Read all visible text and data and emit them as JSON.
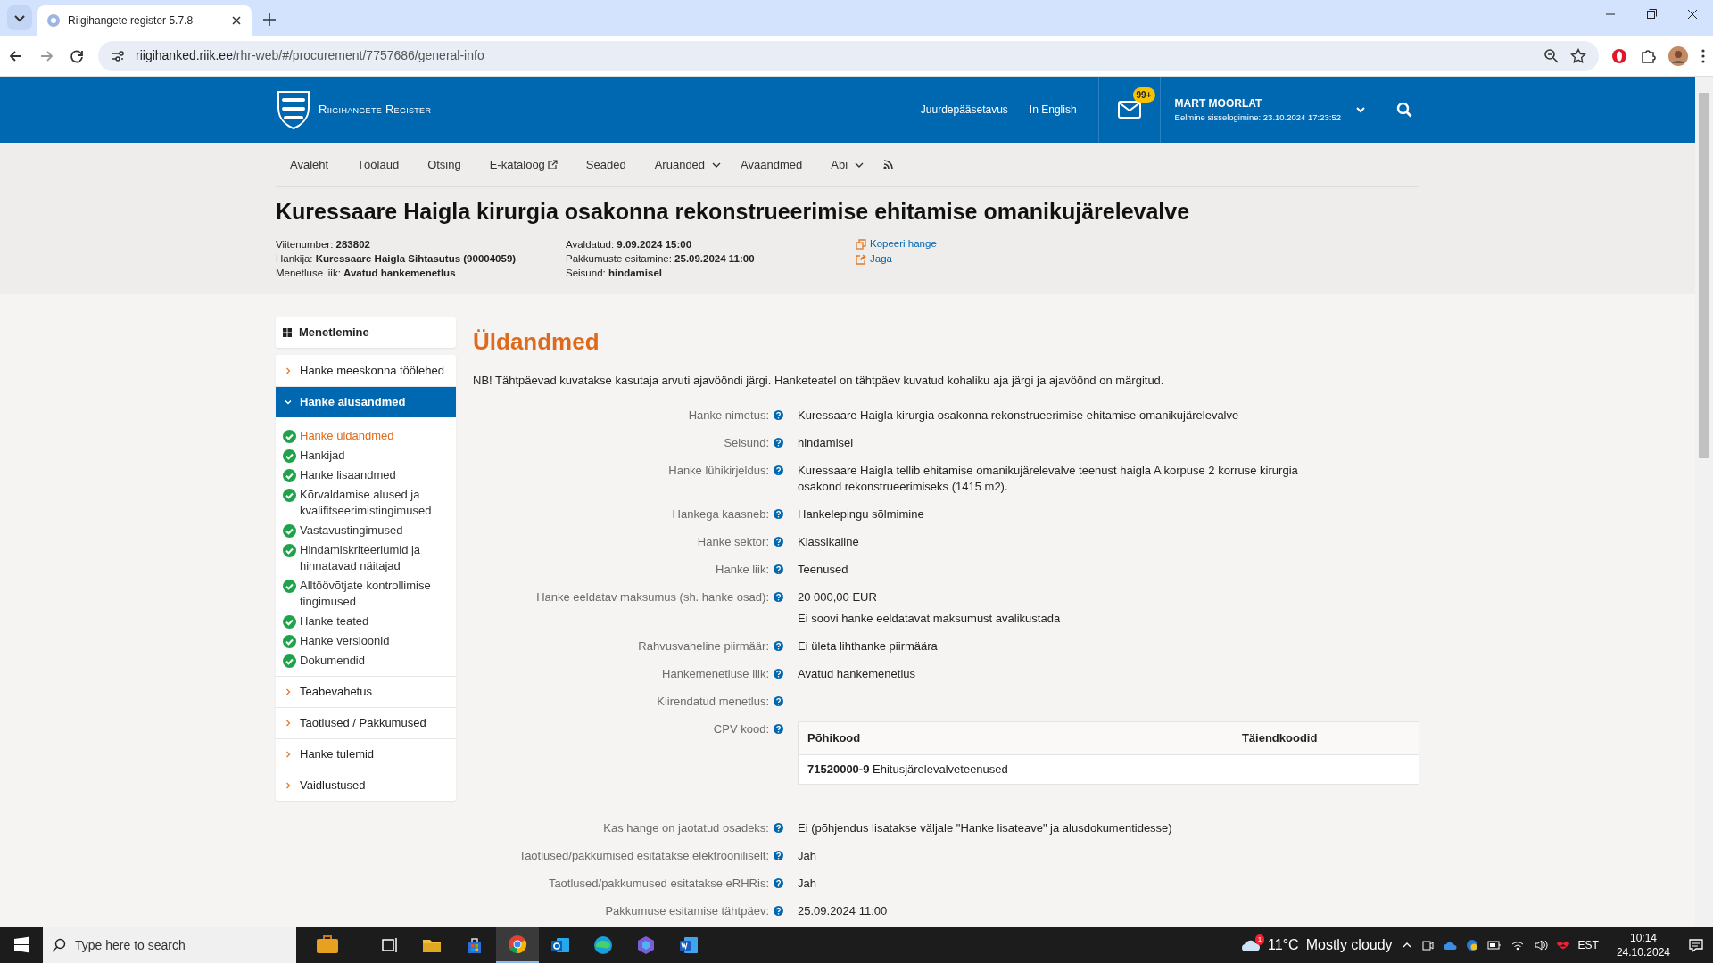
{
  "browser": {
    "tabs": [
      {
        "title": "Riigihangete register 5.7.8",
        "selected": true
      }
    ],
    "url_host": "riigihanked.riik.ee",
    "url_path": "/rhr-web/#/procurement/7757686/general-info"
  },
  "header": {
    "logo_text": "Riigihangete Register",
    "links": [
      "Juurdepääsetavus",
      "In English"
    ],
    "mail_badge": "99+",
    "user_name": "MART MOORLAT",
    "last_login": "Eelmine sisselogimine: 23.10.2024 17:23:52"
  },
  "nav": [
    {
      "kind": "plain",
      "label": "Avaleht"
    },
    {
      "kind": "plain",
      "label": "Töölaud"
    },
    {
      "kind": "plain",
      "label": "Otsing"
    },
    {
      "kind": "external",
      "label": "E-kataloog"
    },
    {
      "kind": "plain",
      "label": "Seaded"
    },
    {
      "kind": "dropdown",
      "label": "Aruanded"
    },
    {
      "kind": "plain",
      "label": "Avaandmed"
    },
    {
      "kind": "dropdown",
      "label": "Abi"
    },
    {
      "kind": "rss"
    }
  ],
  "procurement": {
    "title": "Kuressaare Haigla kirurgia osakonna rekonstrueerimise ehitamise omanikujärelevalve",
    "meta_columns": [
      [
        "Viitenumber: **283802**",
        "Hankija: **Kuressaare Haigla Sihtasutus (90004059)**",
        "Menetluse liik: **Avatud hankemenetlus**"
      ],
      [
        "Avaldatud: **9.09.2024 15:00**",
        "Pakkumuste esitamine: **25.09.2024 11:00**",
        "Seisund: **hindamisel**"
      ]
    ],
    "actions": [
      {
        "kind": "copy",
        "label": "Kopeeri hange"
      },
      {
        "kind": "share",
        "label": "Jaga"
      }
    ]
  },
  "sidebar": {
    "title": "Menetlemine",
    "sections": [
      {
        "label": "Hanke meeskonna töölehed",
        "expanded": false
      },
      {
        "label": "Hanke alusandmed",
        "expanded": true,
        "children": [
          {
            "label": "Hanke üldandmed",
            "done": true,
            "selected": true
          },
          {
            "label": "Hankijad",
            "done": true,
            "selected": false
          },
          {
            "label": "Hanke lisaandmed",
            "done": true,
            "selected": false
          },
          {
            "label": "Kõrvaldamise alused ja kvalifitseerimistingimused",
            "done": true,
            "selected": false
          },
          {
            "label": "Vastavustingimused",
            "done": true,
            "selected": false
          },
          {
            "label": "Hindamiskriteeriumid ja hinnatavad näitajad",
            "done": true,
            "selected": false
          },
          {
            "label": "Alltöövõtjate kontrollimise tingimused",
            "done": true,
            "selected": false
          },
          {
            "label": "Hanke teated",
            "done": true,
            "selected": false
          },
          {
            "label": "Hanke versioonid",
            "done": true,
            "selected": false
          },
          {
            "label": "Dokumendid",
            "done": true,
            "selected": false
          }
        ]
      },
      {
        "label": "Teabevahetus",
        "expanded": false
      },
      {
        "label": "Taotlused / Pakkumused",
        "expanded": false
      },
      {
        "label": "Hanke tulemid",
        "expanded": false
      },
      {
        "label": "Vaidlustused",
        "expanded": false
      }
    ]
  },
  "main": {
    "heading": "Üldandmed",
    "note": "NB! Tähtpäevad kuvatakse kasutaja arvuti ajavööndi järgi. Hanketeatel on tähtpäev kuvatud kohaliku aja järgi ja ajavöönd on märgitud.",
    "fields": [
      {
        "kind": "text",
        "label": "Hanke nimetus:",
        "values": [
          "Kuressaare Haigla kirurgia osakonna rekonstrueerimise ehitamise omanikujärelevalve"
        ]
      },
      {
        "kind": "text",
        "label": "Seisund:",
        "values": [
          "hindamisel"
        ]
      },
      {
        "kind": "text",
        "label": "Hanke lühikirjeldus:",
        "values": [
          "Kuressaare Haigla tellib ehitamise omanikujärelevalve teenust haigla A korpuse 2 korruse kirurgia osakond rekonstrueerimiseks (1415 m2)."
        ]
      },
      {
        "kind": "text",
        "label": "Hankega kaasneb:",
        "values": [
          "Hankelepingu sõlmimine"
        ]
      },
      {
        "kind": "text",
        "label": "Hanke sektor:",
        "values": [
          "Klassikaline"
        ]
      },
      {
        "kind": "text",
        "label": "Hanke liik:",
        "values": [
          "Teenused"
        ]
      },
      {
        "kind": "text",
        "label": "Hanke eeldatav maksumus (sh. hanke osad):",
        "values": [
          "20 000,00 EUR",
          "Ei soovi hanke eeldatavat maksumust avalikustada"
        ]
      },
      {
        "kind": "text",
        "label": "Rahvusvaheline piirmäär:",
        "values": [
          "Ei ületa lihthanke piirmäära"
        ]
      },
      {
        "kind": "text",
        "label": "Hankemenetluse liik:",
        "values": [
          "Avatud hankemenetlus"
        ]
      },
      {
        "kind": "text",
        "label": "Kiirendatud menetlus:"
      },
      {
        "kind": "table",
        "label": "CPV kood:",
        "columns": [
          "Põhikood",
          "Täiendkoodid"
        ],
        "rows": [
          [
            "**71520000-9** Ehitusjärelevalveteenused"
          ]
        ]
      },
      {
        "kind": "text",
        "label": "Kas hange on jaotatud osadeks:",
        "values": [
          "Ei (põhjendus lisatakse väljale \"Hanke lisateave\" ja alusdokumentidesse)"
        ]
      },
      {
        "kind": "text",
        "label": "Taotlused/pakkumised esitatakse elektrooniliselt:",
        "values": [
          "Jah"
        ]
      },
      {
        "kind": "text",
        "label": "Taotlused/pakkumused esitatakse eRHRis:",
        "values": [
          "Jah"
        ]
      },
      {
        "kind": "text",
        "label": "Pakkumuse esitamise tähtpäev:",
        "values": [
          "25.09.2024 11:00"
        ]
      }
    ]
  },
  "taskbar": {
    "search_placeholder": "Type here to search",
    "apps": [
      {
        "kind": "briefcase",
        "selected": false
      },
      {
        "kind": "taskview",
        "selected": false
      },
      {
        "kind": "explorer",
        "selected": false
      },
      {
        "kind": "store",
        "selected": false
      },
      {
        "kind": "chrome",
        "selected": true
      },
      {
        "kind": "outlook",
        "selected": false
      },
      {
        "kind": "edge",
        "selected": false
      },
      {
        "kind": "copilot",
        "selected": false
      },
      {
        "kind": "word",
        "selected": false
      }
    ],
    "weather_badge": "1",
    "temperature": "11°C",
    "weather": "Mostly cloudy",
    "language": "EST",
    "time": "10:14",
    "date": "24.10.2024"
  }
}
